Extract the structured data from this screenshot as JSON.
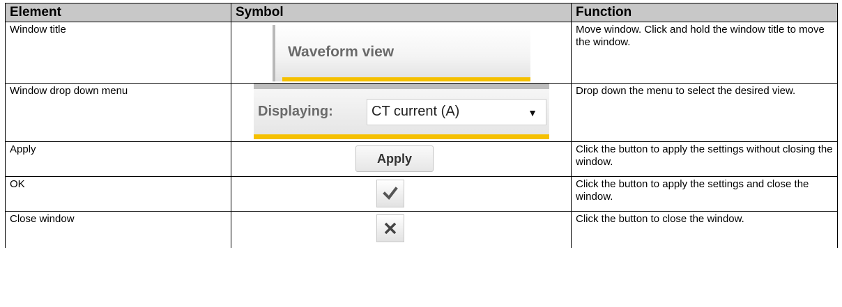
{
  "table": {
    "headers": {
      "element": "Element",
      "symbol": "Symbol",
      "function": "Function"
    },
    "rows": [
      {
        "element": "Window title",
        "symbol_text": "Waveform view",
        "function": "Move window. Click and hold the window title to move the window."
      },
      {
        "element": "Window drop down menu",
        "symbol_label": "Displaying:",
        "symbol_value": "CT current (A)",
        "symbol_arrow": "▼",
        "function": "Drop down the menu to select the desired view."
      },
      {
        "element": "Apply",
        "symbol_text": "Apply",
        "function": "Click the button to apply the settings without closing the window."
      },
      {
        "element": "OK",
        "symbol_icon": "checkmark-icon",
        "function": "Click the button to apply the settings and close the window."
      },
      {
        "element": "Close window",
        "symbol_icon": "close-icon",
        "function": "Click the button to close the window."
      }
    ]
  },
  "colors": {
    "accent_bar": "#f5c000",
    "header_bg": "#c8c8c8",
    "symbol_text": "#6a6a6a"
  }
}
